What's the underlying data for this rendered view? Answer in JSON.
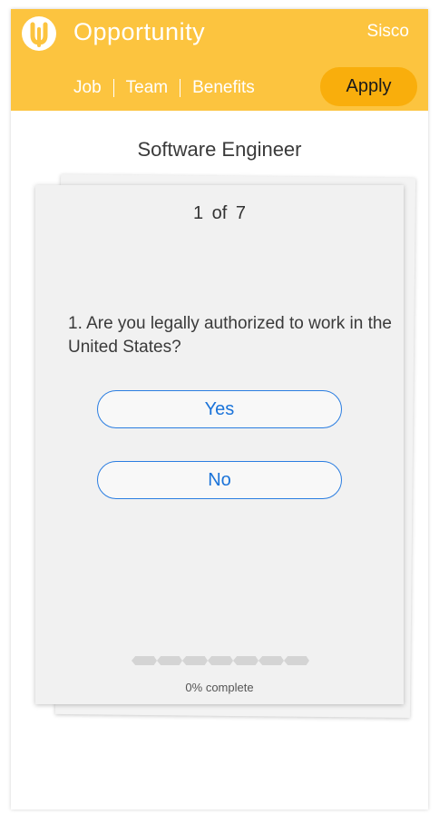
{
  "header": {
    "title": "Opportunity",
    "company": "Sisco",
    "tabs": [
      "Job",
      "Team",
      "Benefits"
    ],
    "apply_label": "Apply",
    "logo_icon": "u-logo-icon"
  },
  "job": {
    "title": "Software Engineer"
  },
  "question": {
    "counter": "1 of 7",
    "text": "1. Are you legally authorized to work in the United States?",
    "options": [
      "Yes",
      "No"
    ]
  },
  "progress": {
    "total_steps": 7,
    "completed_steps": 0,
    "label": "0% complete"
  },
  "colors": {
    "header_bg": "#FCC43F",
    "apply_bg": "#F9AE0C",
    "answer_border": "#2a7de1",
    "answer_text": "#1a73d9"
  }
}
